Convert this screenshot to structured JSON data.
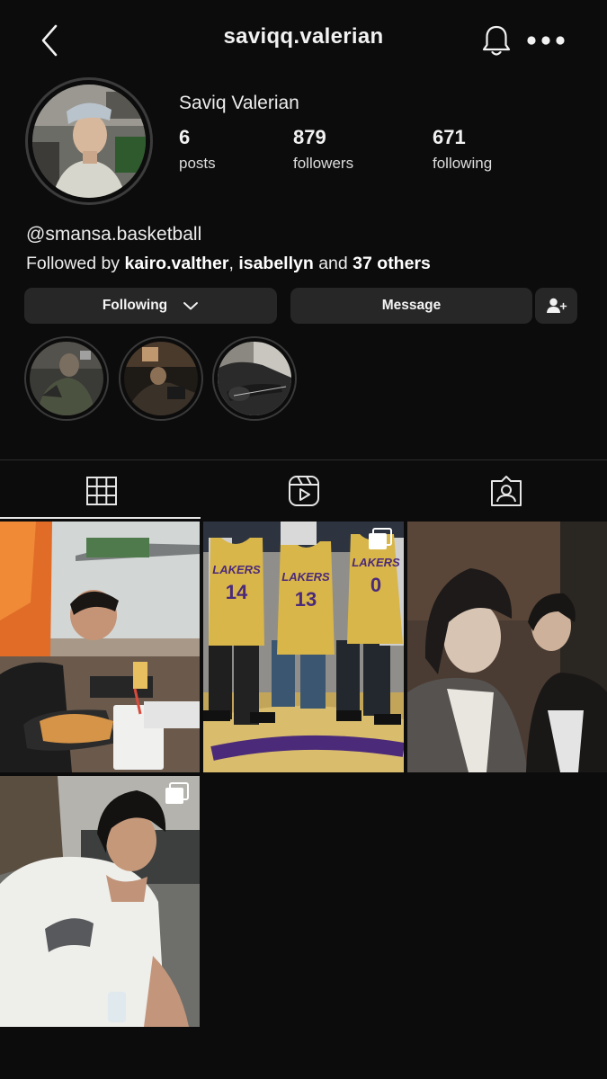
{
  "header": {
    "username": "saviqq.valerian"
  },
  "profile": {
    "display_name": "Saviq Valerian",
    "stats": [
      {
        "value": "6",
        "label": "posts"
      },
      {
        "value": "879",
        "label": "followers"
      },
      {
        "value": "671",
        "label": "following"
      }
    ],
    "bio_link": "@smansa.basketball",
    "followed_by": {
      "prefix": "Followed by",
      "user1": "kairo.valther",
      "sep": ",",
      "user2": "isabellyn",
      "conj": "and",
      "others": "37 others"
    }
  },
  "actions": {
    "following_label": "Following",
    "message_label": "Message"
  },
  "highlights": [
    "highlight-1",
    "highlight-2",
    "highlight-3"
  ],
  "tabs": [
    "grid-icon",
    "reels-icon",
    "tagged-icon"
  ],
  "posts": [
    {
      "description": "photo",
      "multi": false
    },
    {
      "description": "photo",
      "multi": true,
      "jersey_numbers": [
        "14",
        "13",
        "0"
      ],
      "jersey_text": "LAKERS"
    },
    {
      "description": "photo",
      "multi": false
    },
    {
      "description": "photo",
      "multi": true
    }
  ],
  "colors": {
    "background": "#0c0c0c",
    "button": "#272727",
    "text": "#f2f2f2",
    "jersey": "#d9b649",
    "jersey_text": "#4b2a7a"
  }
}
